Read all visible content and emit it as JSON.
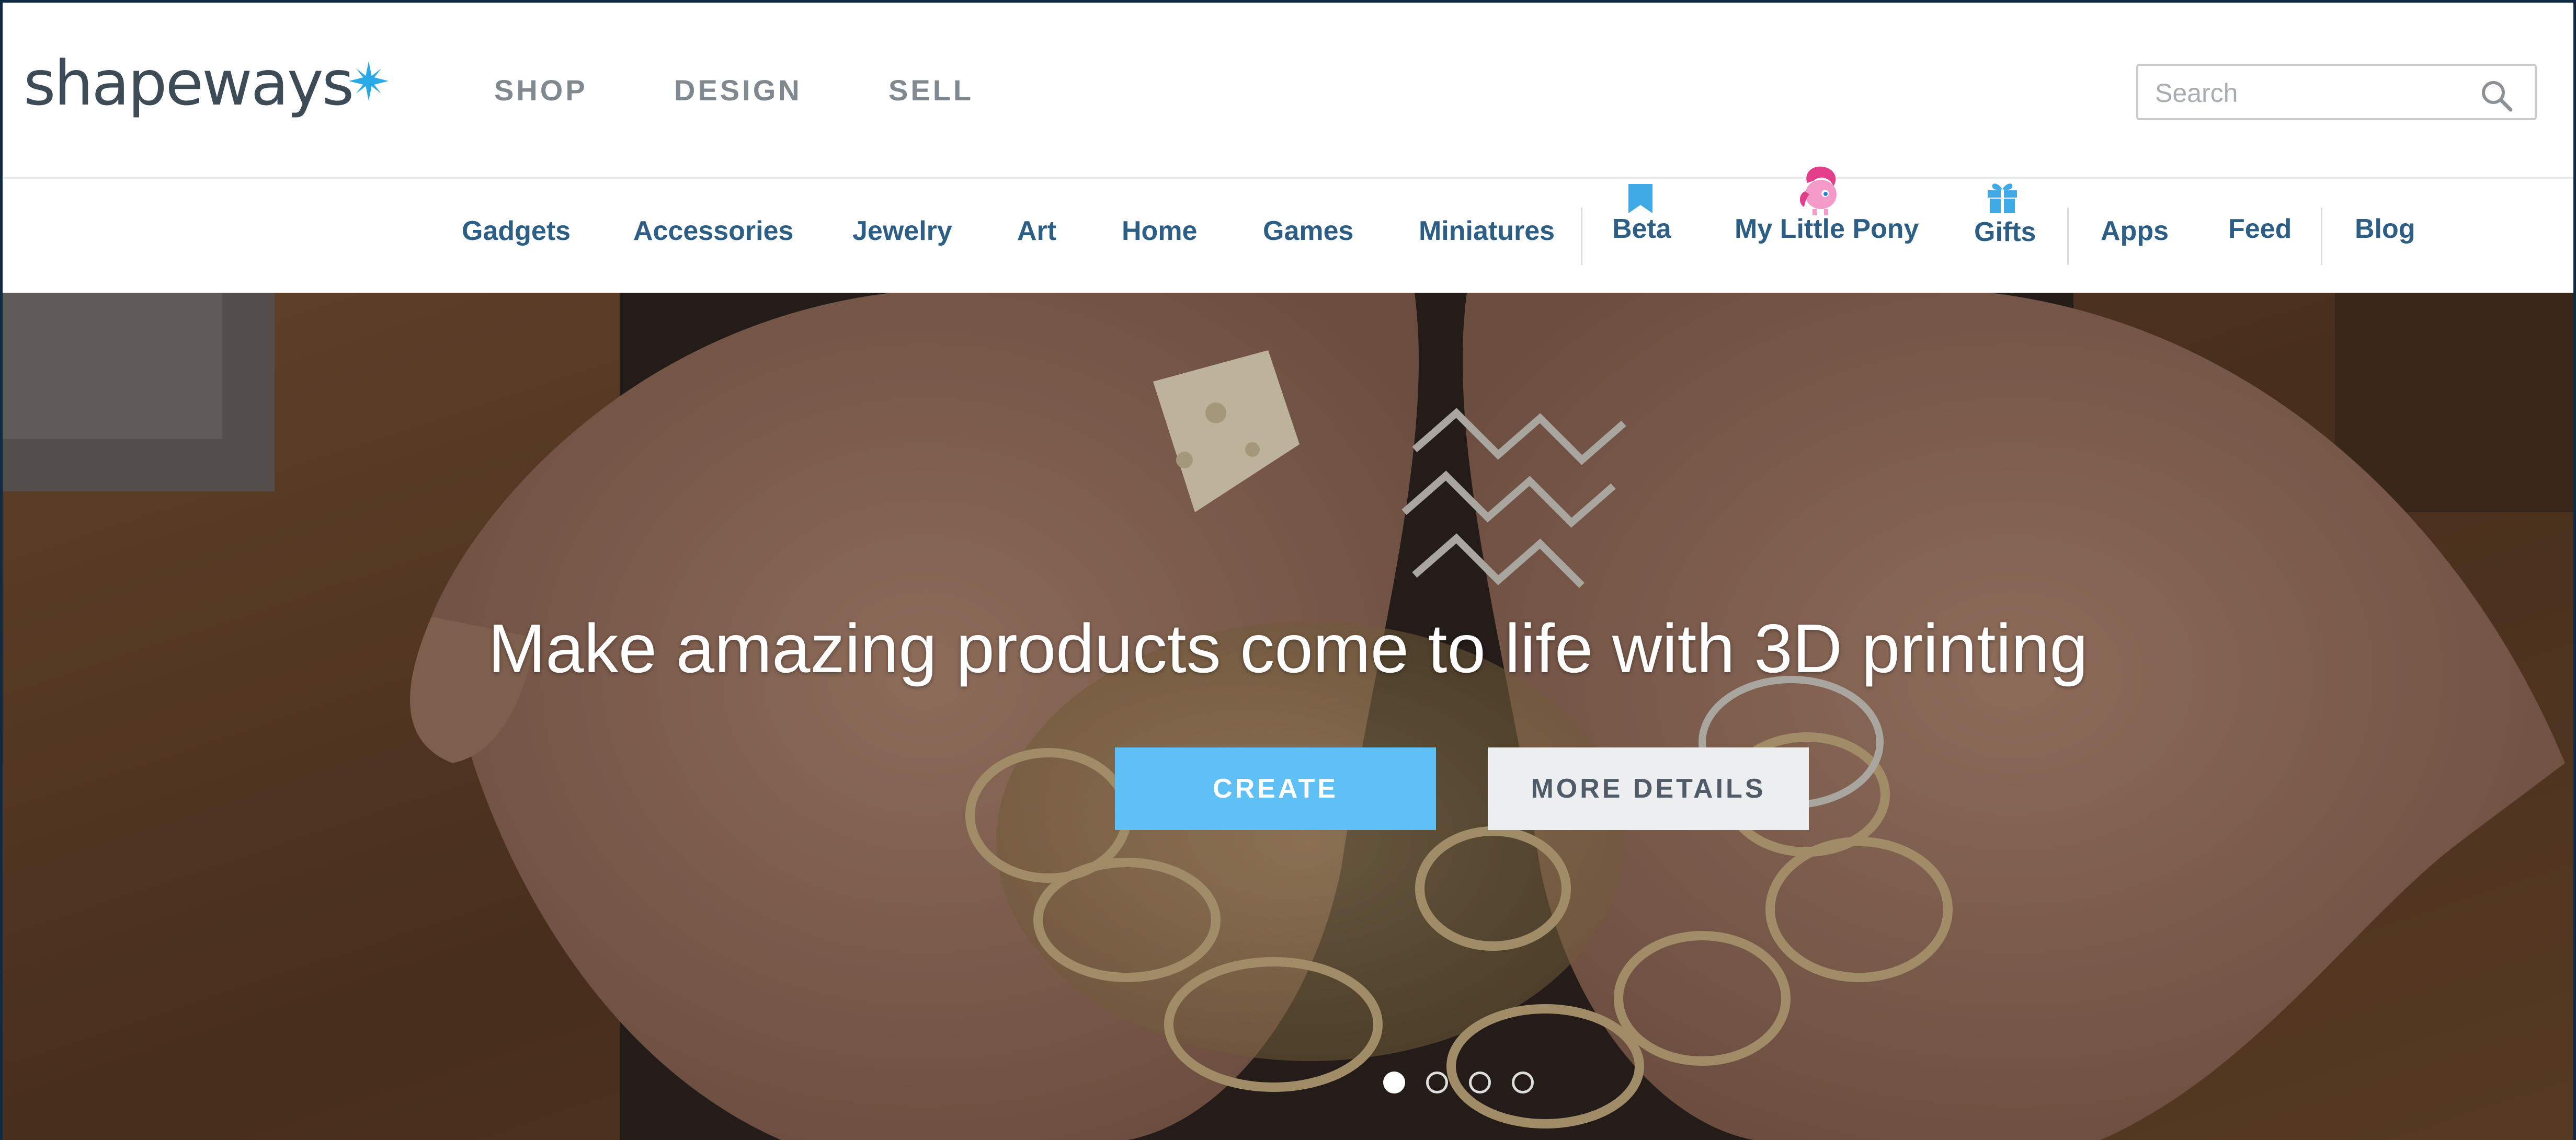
{
  "brand": {
    "name": "shapeways"
  },
  "primary_nav": [
    {
      "label": "SHOP"
    },
    {
      "label": "DESIGN"
    },
    {
      "label": "SELL"
    }
  ],
  "search": {
    "placeholder": "Search",
    "value": ""
  },
  "categories": [
    {
      "label": "Gadgets"
    },
    {
      "label": "Accessories"
    },
    {
      "label": "Jewelry"
    },
    {
      "label": "Art"
    },
    {
      "label": "Home"
    },
    {
      "label": "Games"
    },
    {
      "label": "Miniatures"
    },
    {
      "label": "Beta",
      "icon": "bookmark-icon"
    },
    {
      "label": "My Little Pony",
      "icon": "pony-icon"
    },
    {
      "label": "Gifts",
      "icon": "gift-icon"
    },
    {
      "label": "Apps"
    },
    {
      "label": "Feed"
    },
    {
      "label": "Blog"
    }
  ],
  "hero": {
    "headline": "Make amazing products come to life with 3D printing",
    "create_label": "CREATE",
    "more_label": "MORE DETAILS",
    "slides_total": 4,
    "active_slide": 1
  },
  "colors": {
    "accent": "#5ec0f5",
    "nav_link": "#2d5f86",
    "primary_nav": "#808890",
    "logo_text": "#3d4b57"
  }
}
